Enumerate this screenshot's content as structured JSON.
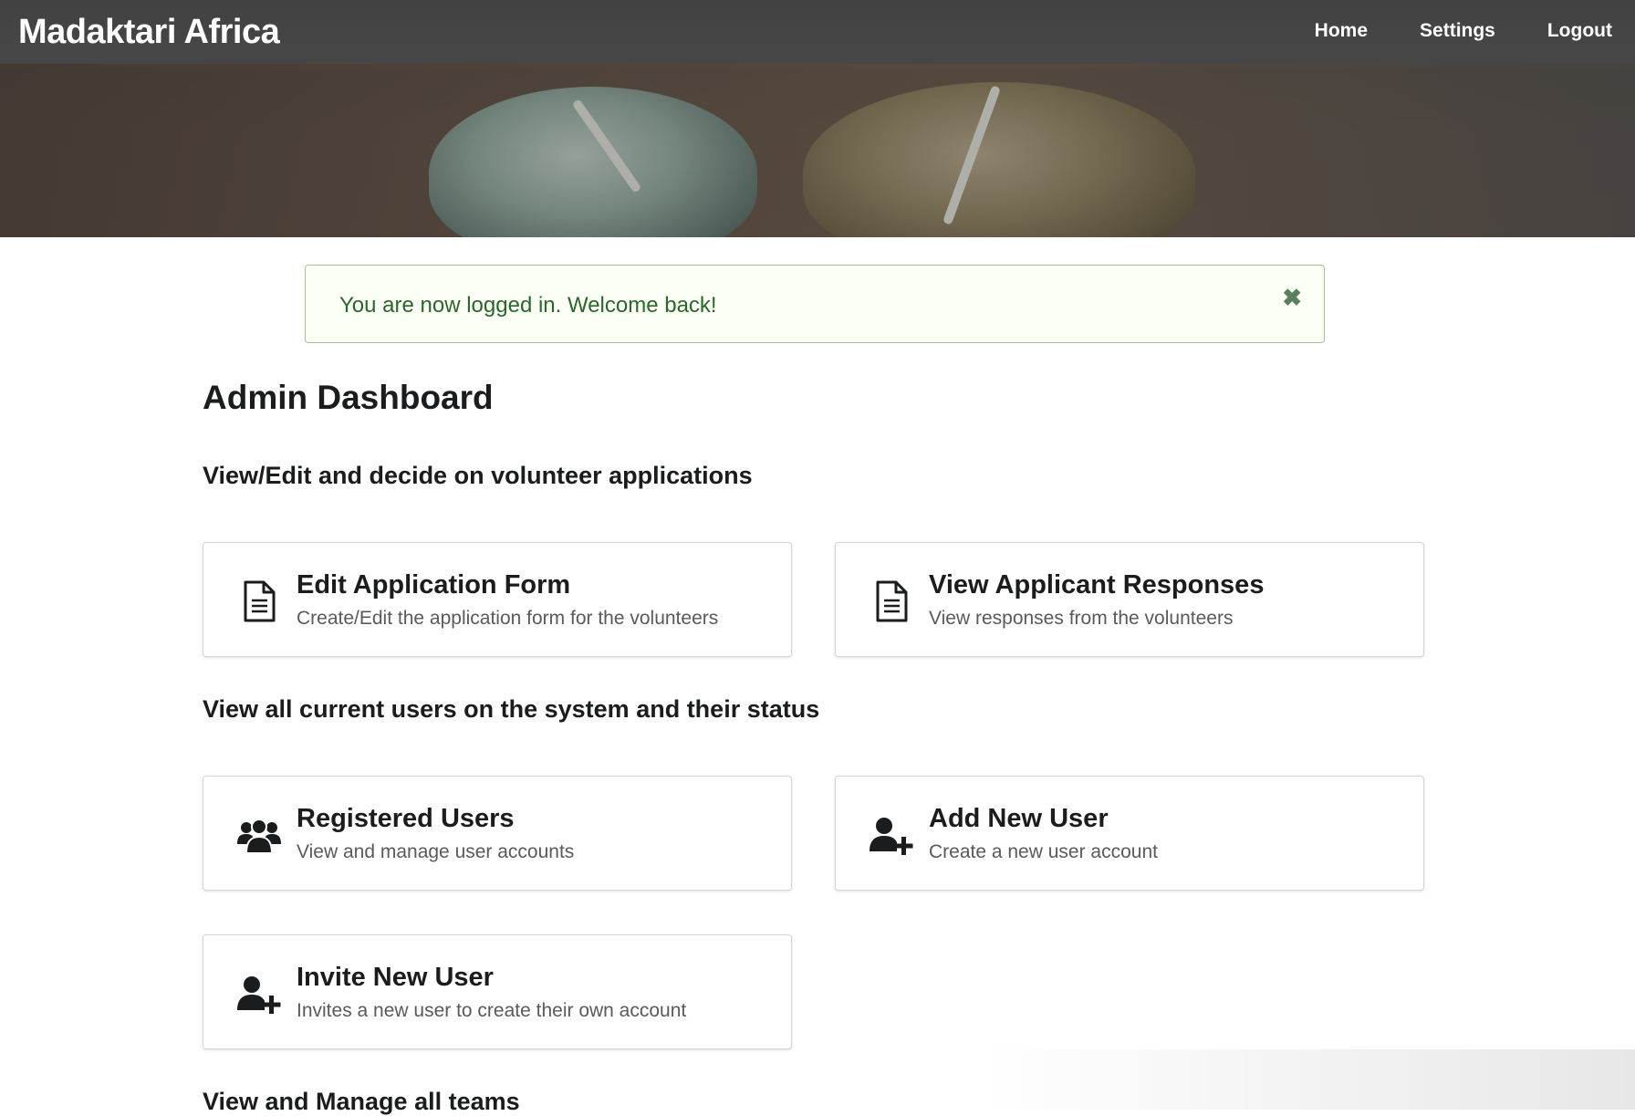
{
  "header": {
    "brand": "Madaktari Africa",
    "nav": [
      {
        "label": "Home"
      },
      {
        "label": "Settings"
      },
      {
        "label": "Logout"
      }
    ]
  },
  "alert": {
    "message": "You are now logged in. Welcome back!",
    "close_icon": "close-icon"
  },
  "page_title": "Admin Dashboard",
  "sections": [
    {
      "heading": "View/Edit and decide on volunteer applications",
      "cards": [
        {
          "title": "Edit Application Form",
          "description": "Create/Edit the application form for the volunteers",
          "icon": "file-text-icon"
        },
        {
          "title": "View Applicant Responses",
          "description": "View responses from the volunteers",
          "icon": "file-text-icon"
        }
      ]
    },
    {
      "heading": "View all current users on the system and their status",
      "cards": [
        {
          "title": "Registered Users",
          "description": "View and manage user accounts",
          "icon": "users-icon"
        },
        {
          "title": "Add New User",
          "description": "Create a new user account",
          "icon": "add-user-icon"
        },
        {
          "title": "Invite New User",
          "description": "Invites a new user to create their own account",
          "icon": "add-user-icon"
        }
      ]
    },
    {
      "heading": "View and Manage all teams"
    }
  ],
  "colors": {
    "alert_border": "#a3c293",
    "alert_background": "#fcfff5",
    "alert_text": "#2c662d",
    "card_border": "#d4d4d5"
  }
}
